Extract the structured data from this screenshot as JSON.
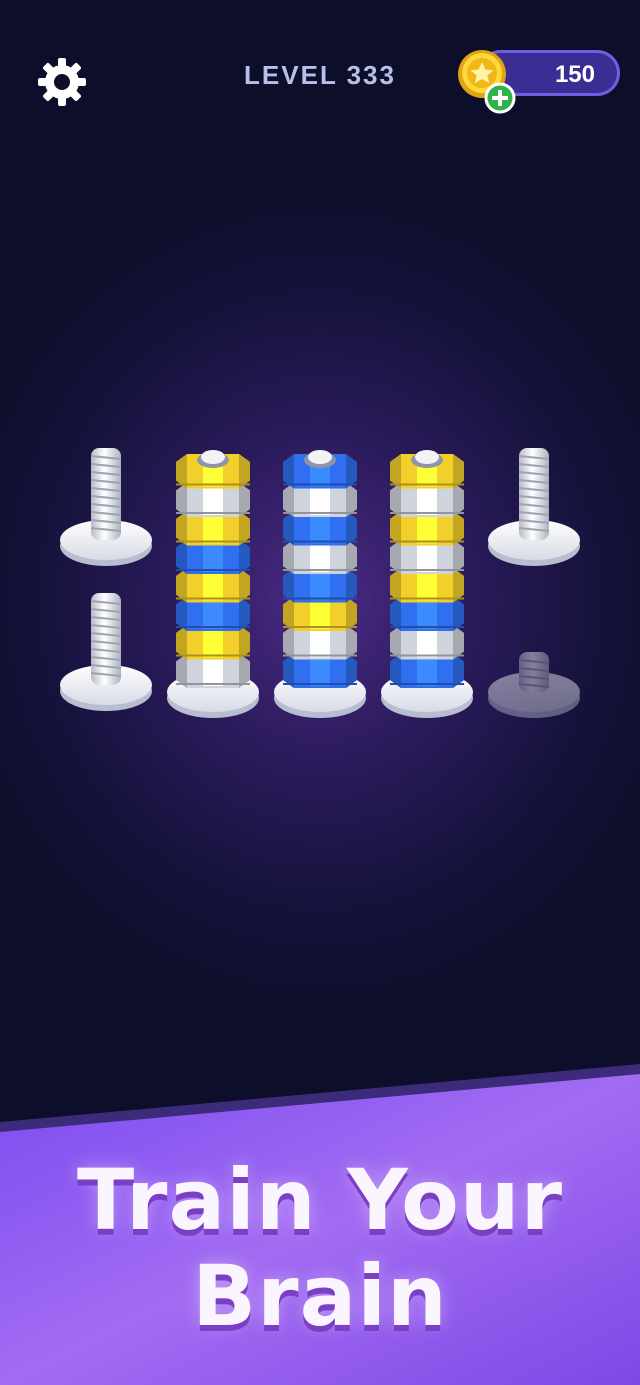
{
  "header": {
    "level_text": "LEVEL 333",
    "coins": "150",
    "settings_icon": "gear-icon",
    "coin_icon": "star-coin-icon",
    "add_icon": "plus-icon"
  },
  "colors": {
    "yellow": "#f2cf2a",
    "blue": "#2f6ff0",
    "silver": "#cfd3dc"
  },
  "board": {
    "towers": [
      {
        "nuts": [
          "yellow",
          "silver",
          "yellow",
          "blue",
          "yellow",
          "blue",
          "yellow",
          "silver"
        ]
      },
      {
        "nuts": [
          "blue",
          "silver",
          "blue",
          "silver",
          "blue",
          "yellow",
          "silver",
          "blue"
        ]
      },
      {
        "nuts": [
          "yellow",
          "silver",
          "yellow",
          "silver",
          "yellow",
          "blue",
          "silver",
          "blue"
        ]
      }
    ],
    "empty_bolts": 4,
    "locked_bolt": 1
  },
  "banner": {
    "line1": "Train Your",
    "line2": "Brain"
  }
}
